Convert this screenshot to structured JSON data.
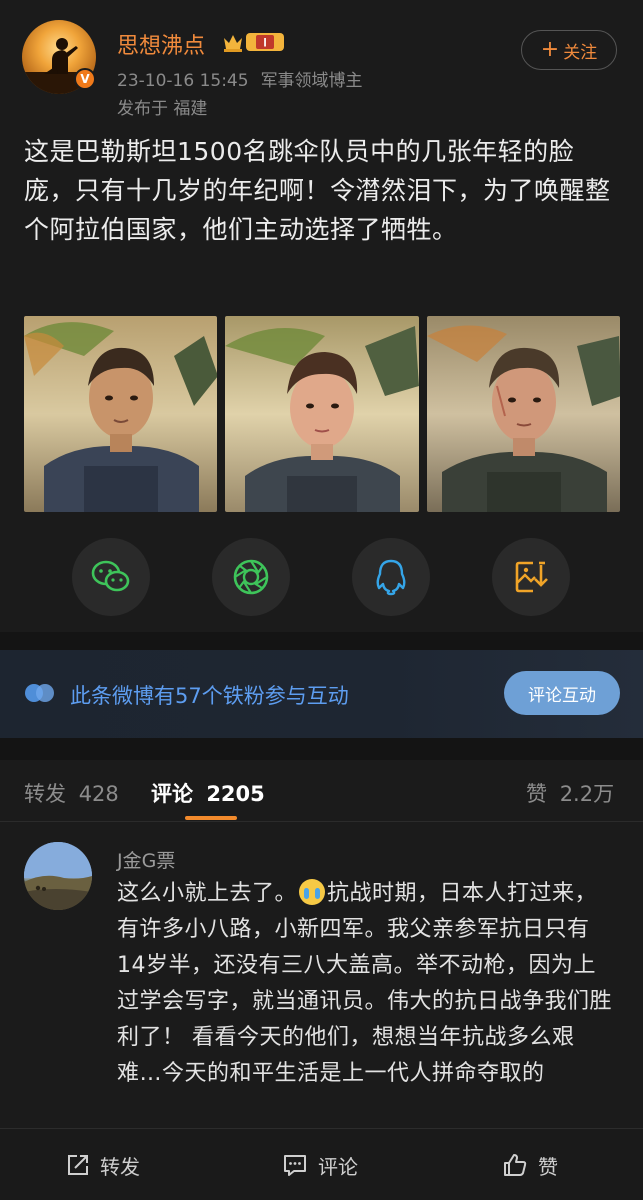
{
  "post": {
    "username": "思想沸点",
    "vip_badge": "I",
    "timestamp": "23-10-16 15:45",
    "blogger_tag": "军事领域博主",
    "location": "发布于 福建",
    "follow_label": "关注",
    "text": "这是巴勒斯坦1500名跳伞队员中的几张年轻的脸庞，只有十几岁的年纪啊！令潸然泪下，为了唤醒整个阿拉伯国家，他们主动选择了牺牲。",
    "images": [
      "photo-1",
      "photo-2",
      "photo-3"
    ]
  },
  "share": {
    "icons": [
      "wechat-icon",
      "moments-icon",
      "qq-icon",
      "save-image-icon"
    ],
    "colors": {
      "wechat": "#3ec45a",
      "moments": "#3ec45a",
      "qq": "#35a5e8",
      "save": "#f0a428"
    }
  },
  "fan_banner": {
    "text": "此条微博有57个铁粉参与互动",
    "button_label": "评论互动",
    "accent": "#5d9df0"
  },
  "tabs": {
    "repost_label": "转发",
    "repost_count": "428",
    "comment_label": "评论",
    "comment_count": "2205",
    "like_label": "赞",
    "like_count": "2.2万",
    "accent": "#f28a2c"
  },
  "comment": {
    "author": "J金G票",
    "text_before_emoji": "这么小就上去了。",
    "text_after_emoji": "抗战时期，日本人打过来，有许多小八路，小新四军。我父亲参军抗日只有14岁半，还没有三八大盖高。举不动枪，因为上过学会写字，就当通讯员。伟大的抗日战争我们胜利了！ 看看今天的他们，想想当年抗战多么艰难…今天的和平生活是上一代人拼命夺取的"
  },
  "bottom_bar": {
    "repost": "转发",
    "comment": "评论",
    "like": "赞"
  }
}
